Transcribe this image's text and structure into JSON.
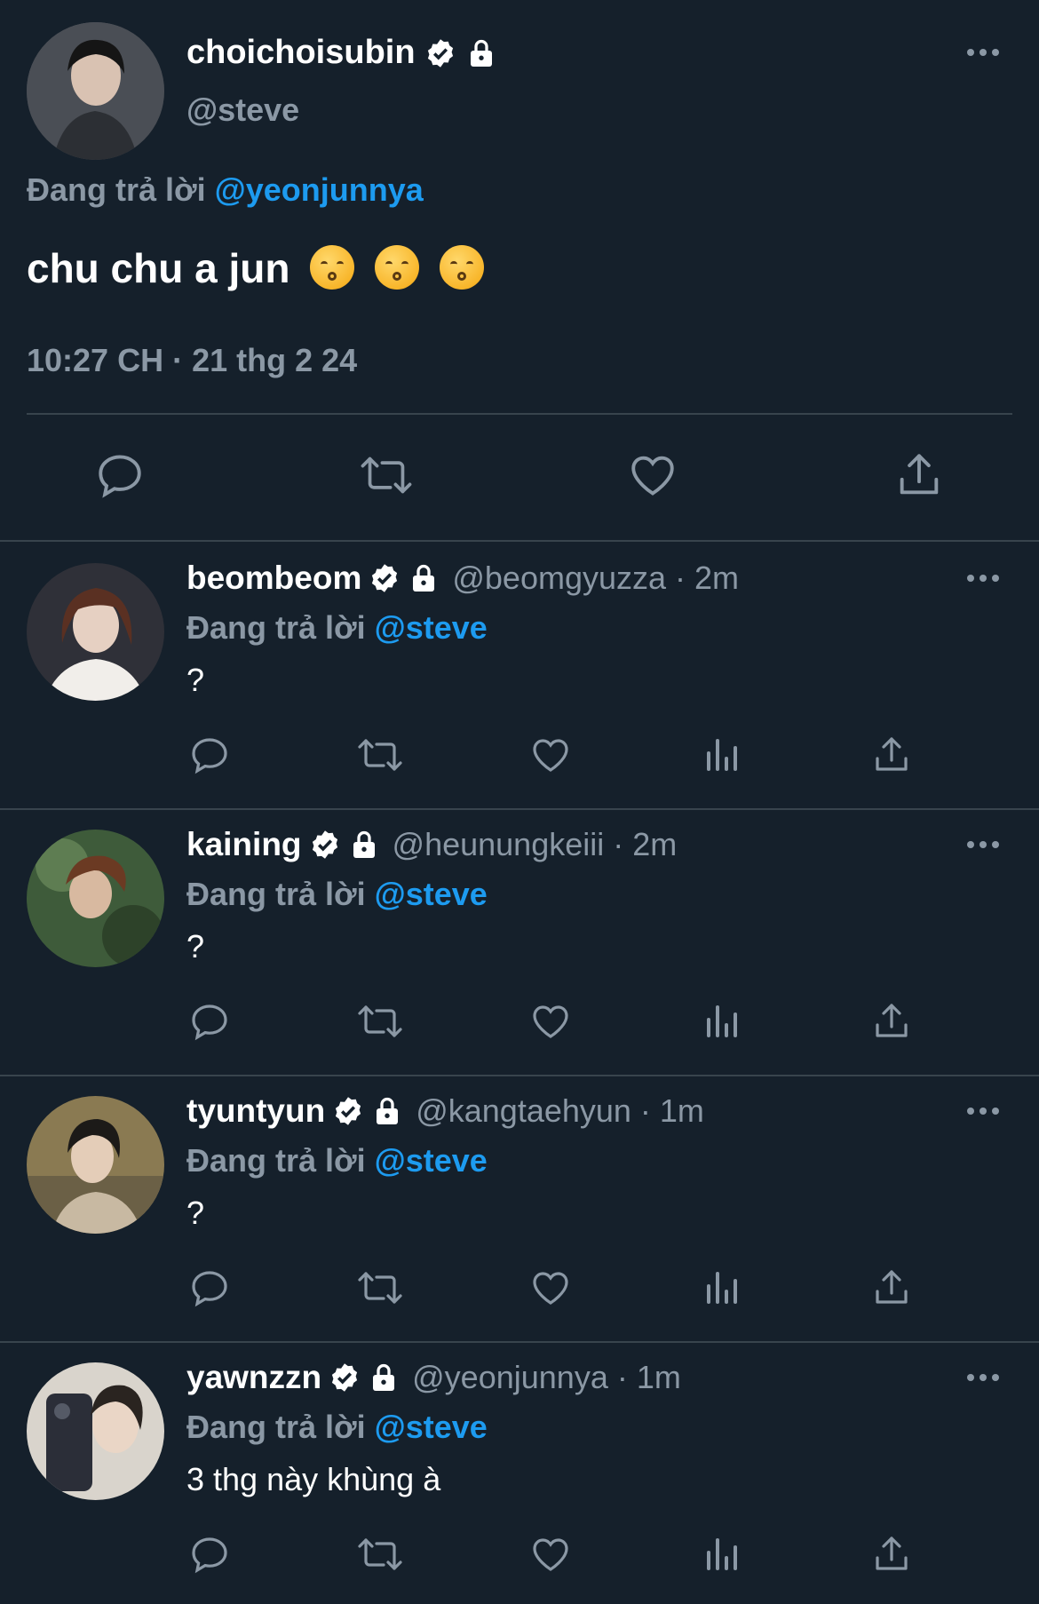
{
  "main_tweet": {
    "name": "choichoisubin",
    "handle": "@steve",
    "replying_prefix": "Đang trả lời",
    "replying_to": "@yeonjunnya",
    "text": "chu chu a jun",
    "emoji_count": 3,
    "timestamp": "10:27 CH · 21 thg 2 24"
  },
  "replies": [
    {
      "name": "beombeom",
      "handle": "@beomgyuzza · 2m",
      "replying_prefix": "Đang trả lời",
      "replying_to": "@steve",
      "text": "?"
    },
    {
      "name": "kaining",
      "handle": "@heunungkeiii · 2m",
      "replying_prefix": "Đang trả lời",
      "replying_to": "@steve",
      "text": "?"
    },
    {
      "name": "tyuntyun",
      "handle": "@kangtaehyun · 1m",
      "replying_prefix": "Đang trả lời",
      "replying_to": "@steve",
      "text": "?"
    },
    {
      "name": "yawnzzn",
      "handle": "@yeonjunnya · 1m",
      "replying_prefix": "Đang trả lời",
      "replying_to": "@steve",
      "text": "3 thg này khùng à"
    }
  ],
  "icons": {
    "verified": "verified-badge-icon",
    "protected": "lock-icon",
    "reply": "reply-icon",
    "retweet": "retweet-icon",
    "like": "heart-icon",
    "views": "analytics-icon",
    "share": "share-icon",
    "more": "more-icon"
  },
  "colors": {
    "background": "#15202b",
    "text_primary": "#ffffff",
    "text_secondary": "#8b98a5",
    "accent": "#1d9bf0",
    "divider": "#38444d"
  }
}
